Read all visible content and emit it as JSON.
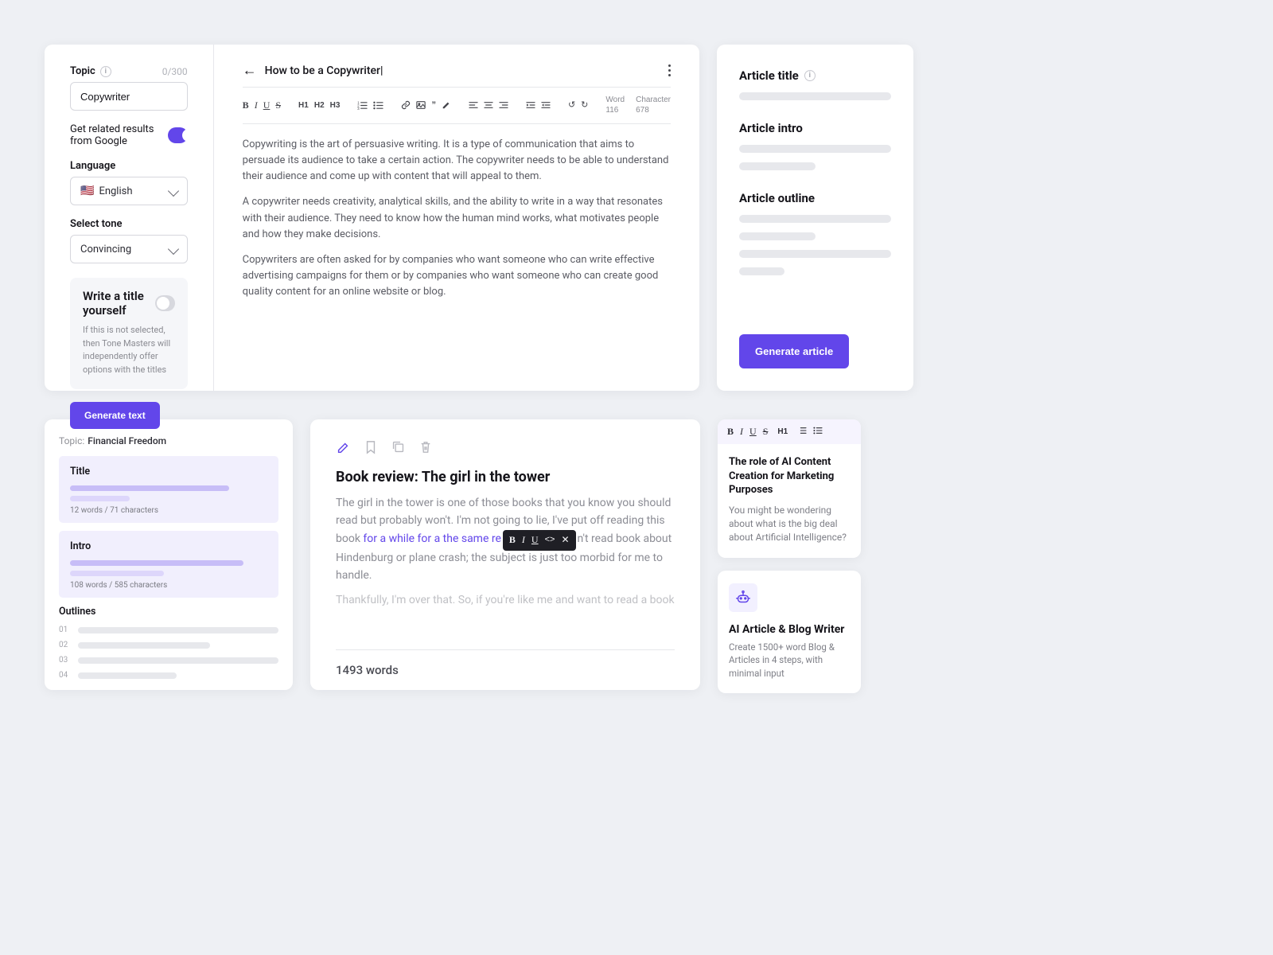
{
  "form": {
    "topic": {
      "label": "Topic",
      "counter": "0/300",
      "value": "Copywriter"
    },
    "google": {
      "label": "Get related results from Google",
      "on": true
    },
    "language": {
      "label": "Language",
      "value": "English",
      "flag": "🇺🇸"
    },
    "tone": {
      "label": "Select tone",
      "value": "Convincing"
    },
    "titleOpt": {
      "title": "Write a title yourself",
      "desc": "If this is not selected, then Tone Masters will independently offer options with the titles",
      "on": false
    },
    "button": "Generate text"
  },
  "editor": {
    "title": "How to be a Copywriter",
    "stats": {
      "word_label": "Word",
      "word": "116",
      "char_label": "Character",
      "char": "678"
    },
    "paragraphs": [
      "Copywriting is the art of persuasive writing. It is a type of communication that aims to persuade its audience to take a certain action. The copywriter needs to be able to understand their audience and come up with content that will appeal to them.",
      "A copywriter needs creativity, analytical skills, and the ability to write in a way that resonates with their audience. They need to know how the human mind works, what motivates people and how they make decisions.",
      "Copywriters are often asked for by companies who want someone who can write effective advertising campaigns for them or by companies who want someone who can create good quality content for an online website or blog."
    ]
  },
  "article": {
    "section1": "Article title",
    "section2": "Article intro",
    "section3": "Article outline",
    "button": "Generate article"
  },
  "outline": {
    "topic_label": "Topic:",
    "topic": "Financial Freedom",
    "title": {
      "label": "Title",
      "meta": "12 words / 71 characters"
    },
    "intro": {
      "label": "Intro",
      "meta": "108 words / 585 characters"
    },
    "outlines": {
      "label": "Outlines",
      "items": [
        "01",
        "02",
        "03",
        "04"
      ]
    }
  },
  "doc": {
    "title": "Book review: The girl in the tower",
    "p1a": "The girl in the tower is one of those books that you know you should read but probably won't. I'm not going to lie, I've put off reading this book ",
    "p1b": "for a while for a the same re",
    "p1c": "n't read book about Hindenburg or plane crash; the subject is just too morbid for me to handle.",
    "p2": "Thankfully, I'm over that. So, if you're like me and want to read a book",
    "footer": "1493 words"
  },
  "suggest": {
    "title": "The role of AI Content Creation for Marketing Purposes",
    "text": "You might be wondering about what is the big deal about Artificial Intelligence?"
  },
  "tool": {
    "title": "AI Article & Blog Writer",
    "text": "Create 1500+ word Blog & Articles in 4 steps, with minimal input"
  }
}
